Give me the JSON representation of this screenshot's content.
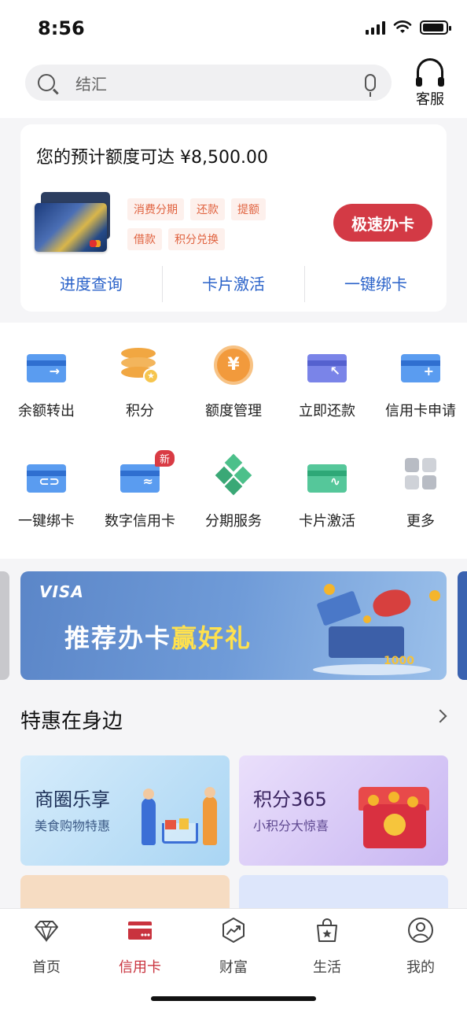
{
  "status_bar": {
    "time": "8:56"
  },
  "search": {
    "placeholder": "结汇",
    "service_label": "客服"
  },
  "promo": {
    "title": "您的预计额度可达 ¥8,500.00",
    "tags": [
      "消费分期",
      "还款",
      "提额",
      "借款",
      "积分兑换"
    ],
    "apply_label": "极速办卡",
    "links": [
      "进度查询",
      "卡片激活",
      "一键绑卡"
    ]
  },
  "quick_grid": [
    {
      "label": "余额转出",
      "icon": "balance-transfer-icon"
    },
    {
      "label": "积分",
      "icon": "points-icon"
    },
    {
      "label": "额度管理",
      "icon": "credit-limit-icon"
    },
    {
      "label": "立即还款",
      "icon": "repay-icon"
    },
    {
      "label": "信用卡申请",
      "icon": "card-apply-icon"
    },
    {
      "label": "一键绑卡",
      "icon": "bind-card-icon"
    },
    {
      "label": "数字信用卡",
      "icon": "digital-card-icon",
      "badge": "新"
    },
    {
      "label": "分期服务",
      "icon": "installment-icon"
    },
    {
      "label": "卡片激活",
      "icon": "card-activate-icon"
    },
    {
      "label": "更多",
      "icon": "more-icon"
    }
  ],
  "banner": {
    "brand": "VISA",
    "title_main": "推荐办卡",
    "title_highlight": "赢好礼",
    "badge_text": "1000"
  },
  "section": {
    "title": "特惠在身边"
  },
  "offers": [
    {
      "title": "商圈乐享",
      "subtitle": "美食购物特惠"
    },
    {
      "title": "积分365",
      "subtitle": "小积分大惊喜"
    }
  ],
  "tabbar": [
    {
      "label": "首页",
      "icon": "diamond-icon",
      "active": false
    },
    {
      "label": "信用卡",
      "icon": "credit-card-icon",
      "active": true
    },
    {
      "label": "财富",
      "icon": "wealth-chart-icon",
      "active": false
    },
    {
      "label": "生活",
      "icon": "shopping-bag-icon",
      "active": false
    },
    {
      "label": "我的",
      "icon": "profile-icon",
      "active": false
    }
  ],
  "colors": {
    "brand_red": "#d33a45",
    "link_blue": "#2a62c9",
    "tag_orange": "#e0623f"
  }
}
